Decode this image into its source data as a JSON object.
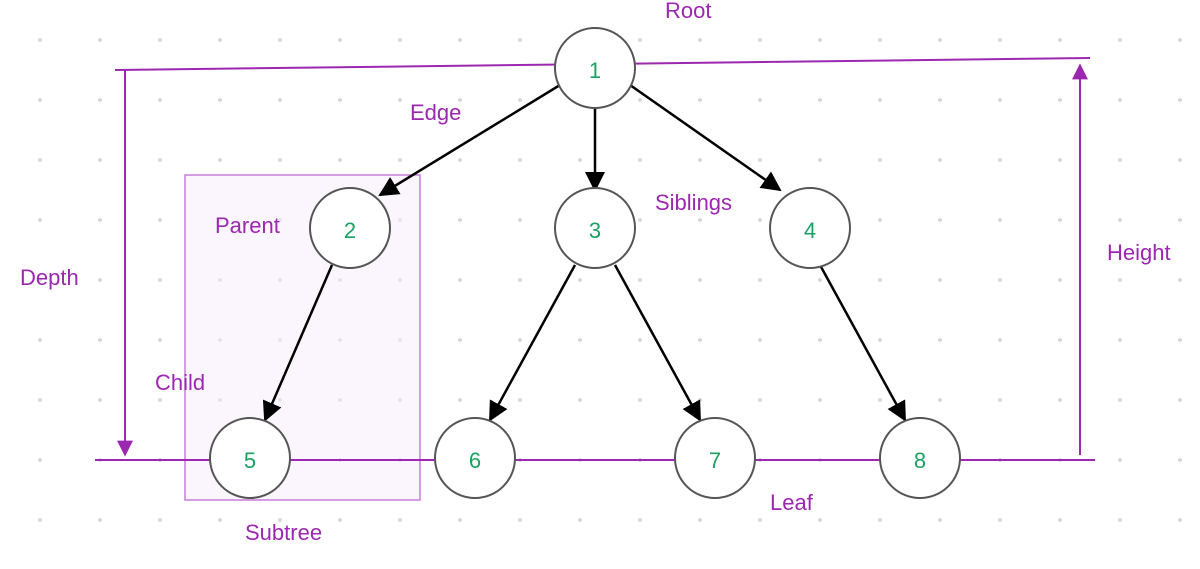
{
  "diagram": {
    "nodes": {
      "n1": "1",
      "n2": "2",
      "n3": "3",
      "n4": "4",
      "n5": "5",
      "n6": "6",
      "n7": "7",
      "n8": "8"
    },
    "labels": {
      "root": "Root",
      "edge": "Edge",
      "parent": "Parent",
      "child": "Child",
      "siblings": "Siblings",
      "leaf": "Leaf",
      "subtree": "Subtree",
      "depth": "Depth",
      "height": "Height"
    },
    "colors": {
      "node_stroke": "#555555",
      "node_text": "#1aa260",
      "annotation": "#9c27b0",
      "subtree_fill": "#f8eefb",
      "edge": "#000000"
    }
  }
}
